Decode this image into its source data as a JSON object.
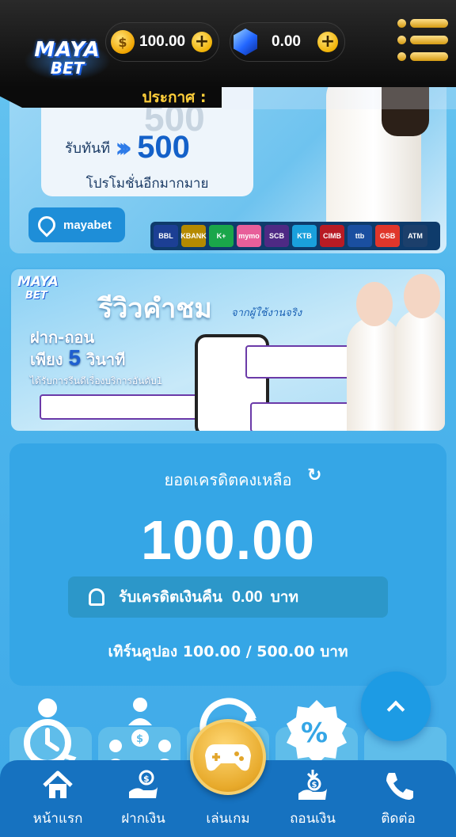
{
  "header": {
    "logo_line1": "MAYA",
    "logo_line2": "BET",
    "credit_value": "100.00",
    "gem_value": "0.00",
    "announce_label": "ประกาศ :"
  },
  "banner1": {
    "ghost_text": "500",
    "receive_label": "รับทันที",
    "receive_amount": "500",
    "sub_label": "โปรโมชั่นอีกมากมาย",
    "location_label": "mayabet",
    "banks": [
      {
        "name": "BBL",
        "color": "#1c3f94"
      },
      {
        "name": "KBANK",
        "color": "#b58a00"
      },
      {
        "name": "K+",
        "color": "#1aa64a"
      },
      {
        "name": "mymo",
        "color": "#e85f9a"
      },
      {
        "name": "SCB",
        "color": "#4e2a84"
      },
      {
        "name": "KTB",
        "color": "#1aa0dc"
      },
      {
        "name": "CIMB",
        "color": "#b81b24"
      },
      {
        "name": "ttb",
        "color": "#1a4fa0"
      },
      {
        "name": "GSB",
        "color": "#e0362b"
      },
      {
        "name": "ATM",
        "color": "#1c3f6b"
      }
    ]
  },
  "banner2": {
    "logo_line1": "MAYA",
    "logo_line2": "BET",
    "title": "รีวิวคำชม",
    "title_sub": "จากผู้ใช้งานจริง",
    "left_line1": "ฝาก-ถอน",
    "left_line2a": "เพียง",
    "left_line2b": "5",
    "left_line2c": "วินาที",
    "left_line3": "ได้รับการรีนดีเรื่องบริการอันดับ1"
  },
  "balance": {
    "title": "ยอดเครดิตคงเหลือ",
    "amount": "100.00",
    "cashback_label": "รับเครดิตเงินคืน",
    "cashback_amount": "0.00",
    "cashback_unit": "บาท",
    "coupon_text": "เทิร์นคูปอง 100.00 / 500.00 บาท"
  },
  "bottom_nav": [
    {
      "label": "หน้าแรก",
      "icon": "home-icon"
    },
    {
      "label": "ฝากเงิน",
      "icon": "deposit-icon"
    },
    {
      "label": "เล่นเกม",
      "icon": "gamepad-icon"
    },
    {
      "label": "ถอนเงิน",
      "icon": "withdraw-icon"
    },
    {
      "label": "ติดต่อ",
      "icon": "phone-icon"
    }
  ],
  "colors": {
    "nav_bg": "#1672c0",
    "card_bg": "#35a6e6",
    "gold": "#f0b000",
    "accent_blue": "#1d9be4"
  }
}
